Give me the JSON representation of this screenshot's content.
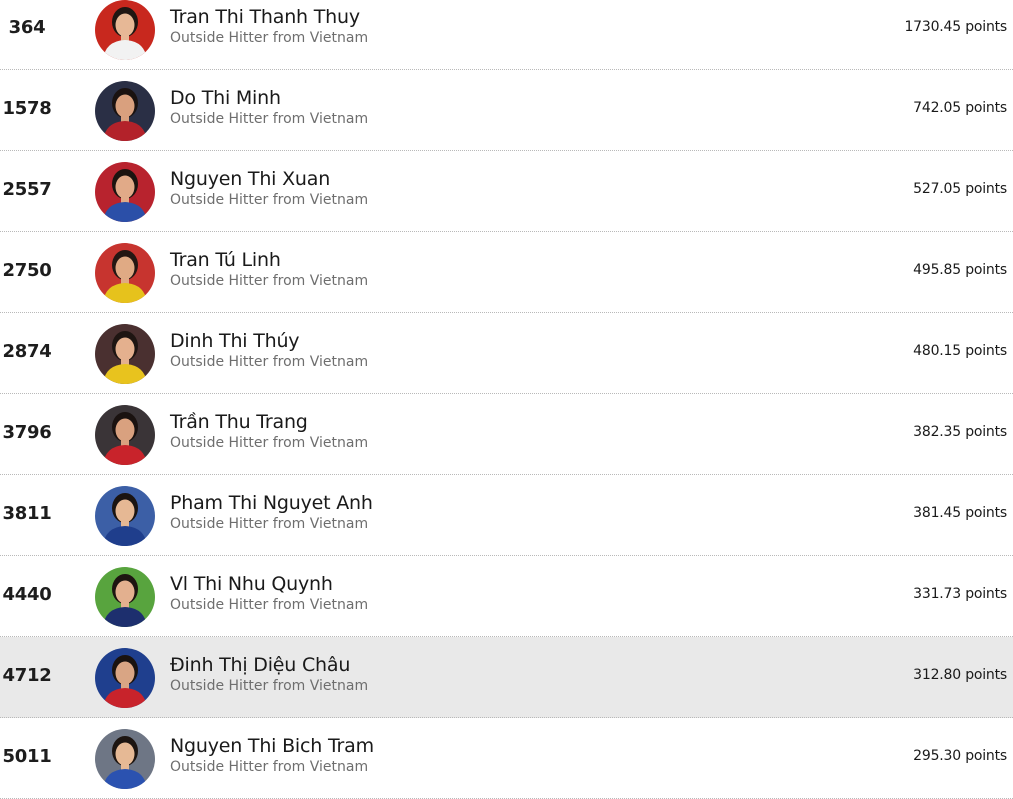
{
  "players": [
    {
      "rank": "364",
      "name": "Tran Thi Thanh Thuy",
      "role": "Outside Hitter from Vietnam",
      "points": "1730.45 points",
      "avatar": {
        "bg": "#c8281e",
        "skin": "#e7b896",
        "hair": "#1f1612",
        "jersey": "#f2f2f2"
      }
    },
    {
      "rank": "1578",
      "name": "Do Thi Minh",
      "role": "Outside Hitter from Vietnam",
      "points": "742.05 points",
      "avatar": {
        "bg": "#2a2f45",
        "skin": "#d9a07e",
        "hair": "#1a1210",
        "jersey": "#b3222a"
      }
    },
    {
      "rank": "2557",
      "name": "Nguyen Thi Xuan",
      "role": "Outside Hitter from Vietnam",
      "points": "527.05 points",
      "avatar": {
        "bg": "#b8232e",
        "skin": "#e1aa88",
        "hair": "#1c1410",
        "jersey": "#2b4fa8"
      }
    },
    {
      "rank": "2750",
      "name": "Tran Tú Linh",
      "role": "Outside Hitter from Vietnam",
      "points": "495.85 points",
      "avatar": {
        "bg": "#c7342f",
        "skin": "#e0aa84",
        "hair": "#241713",
        "jersey": "#e6c21c"
      }
    },
    {
      "rank": "2874",
      "name": "Dinh Thi Thúy",
      "role": "Outside Hitter from Vietnam",
      "points": "480.15 points",
      "avatar": {
        "bg": "#4a3030",
        "skin": "#e4b08e",
        "hair": "#1e1512",
        "jersey": "#e8c31e"
      }
    },
    {
      "rank": "3796",
      "name": "Trần Thu Trang",
      "role": "Outside Hitter from Vietnam",
      "points": "382.35 points",
      "avatar": {
        "bg": "#3a3437",
        "skin": "#d9a17f",
        "hair": "#1a1210",
        "jersey": "#c8232b"
      }
    },
    {
      "rank": "3811",
      "name": "Pham Thi Nguyet Anh",
      "role": "Outside Hitter from Vietnam",
      "points": "381.45 points",
      "avatar": {
        "bg": "#3c5fa6",
        "skin": "#e6b894",
        "hair": "#1b1411",
        "jersey": "#1f3e8c"
      }
    },
    {
      "rank": "4440",
      "name": "Vl Thi Nhu Quynh",
      "role": "Outside Hitter from Vietnam",
      "points": "331.73 points",
      "avatar": {
        "bg": "#58a43e",
        "skin": "#e3b08f",
        "hair": "#1d1511",
        "jersey": "#1d2f6e"
      }
    },
    {
      "rank": "4712",
      "name": "Đinh Thị Diệu Châu",
      "role": "Outside Hitter from Vietnam",
      "points": "312.80 points",
      "avatar": {
        "bg": "#1f3f8e",
        "skin": "#d9a584",
        "hair": "#1a1310",
        "jersey": "#c8232b"
      }
    },
    {
      "rank": "5011",
      "name": "Nguyen Thi Bich Tram",
      "role": "Outside Hitter from Vietnam",
      "points": "295.30 points",
      "avatar": {
        "bg": "#6e7685",
        "skin": "#e6b995",
        "hair": "#1d1511",
        "jersey": "#2b52b0"
      }
    }
  ],
  "highlighted_row": "4712",
  "colors": {
    "highlight": "#e9e9e9",
    "divider": "#b9b9b9",
    "rank_text": "#1d1d1d",
    "role_text": "#6e6e6e"
  }
}
